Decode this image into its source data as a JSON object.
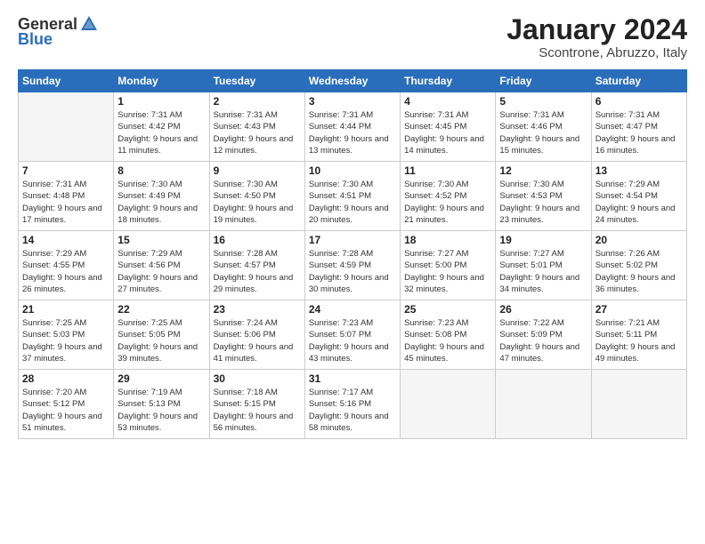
{
  "header": {
    "logo_general": "General",
    "logo_blue": "Blue",
    "month_title": "January 2024",
    "subtitle": "Scontrone, Abruzzo, Italy"
  },
  "days_of_week": [
    "Sunday",
    "Monday",
    "Tuesday",
    "Wednesday",
    "Thursday",
    "Friday",
    "Saturday"
  ],
  "weeks": [
    [
      {
        "day": "",
        "sunrise": "",
        "sunset": "",
        "daylight": ""
      },
      {
        "day": "1",
        "sunrise": "Sunrise: 7:31 AM",
        "sunset": "Sunset: 4:42 PM",
        "daylight": "Daylight: 9 hours and 11 minutes."
      },
      {
        "day": "2",
        "sunrise": "Sunrise: 7:31 AM",
        "sunset": "Sunset: 4:43 PM",
        "daylight": "Daylight: 9 hours and 12 minutes."
      },
      {
        "day": "3",
        "sunrise": "Sunrise: 7:31 AM",
        "sunset": "Sunset: 4:44 PM",
        "daylight": "Daylight: 9 hours and 13 minutes."
      },
      {
        "day": "4",
        "sunrise": "Sunrise: 7:31 AM",
        "sunset": "Sunset: 4:45 PM",
        "daylight": "Daylight: 9 hours and 14 minutes."
      },
      {
        "day": "5",
        "sunrise": "Sunrise: 7:31 AM",
        "sunset": "Sunset: 4:46 PM",
        "daylight": "Daylight: 9 hours and 15 minutes."
      },
      {
        "day": "6",
        "sunrise": "Sunrise: 7:31 AM",
        "sunset": "Sunset: 4:47 PM",
        "daylight": "Daylight: 9 hours and 16 minutes."
      }
    ],
    [
      {
        "day": "7",
        "sunrise": "Sunrise: 7:31 AM",
        "sunset": "Sunset: 4:48 PM",
        "daylight": "Daylight: 9 hours and 17 minutes."
      },
      {
        "day": "8",
        "sunrise": "Sunrise: 7:30 AM",
        "sunset": "Sunset: 4:49 PM",
        "daylight": "Daylight: 9 hours and 18 minutes."
      },
      {
        "day": "9",
        "sunrise": "Sunrise: 7:30 AM",
        "sunset": "Sunset: 4:50 PM",
        "daylight": "Daylight: 9 hours and 19 minutes."
      },
      {
        "day": "10",
        "sunrise": "Sunrise: 7:30 AM",
        "sunset": "Sunset: 4:51 PM",
        "daylight": "Daylight: 9 hours and 20 minutes."
      },
      {
        "day": "11",
        "sunrise": "Sunrise: 7:30 AM",
        "sunset": "Sunset: 4:52 PM",
        "daylight": "Daylight: 9 hours and 21 minutes."
      },
      {
        "day": "12",
        "sunrise": "Sunrise: 7:30 AM",
        "sunset": "Sunset: 4:53 PM",
        "daylight": "Daylight: 9 hours and 23 minutes."
      },
      {
        "day": "13",
        "sunrise": "Sunrise: 7:29 AM",
        "sunset": "Sunset: 4:54 PM",
        "daylight": "Daylight: 9 hours and 24 minutes."
      }
    ],
    [
      {
        "day": "14",
        "sunrise": "Sunrise: 7:29 AM",
        "sunset": "Sunset: 4:55 PM",
        "daylight": "Daylight: 9 hours and 26 minutes."
      },
      {
        "day": "15",
        "sunrise": "Sunrise: 7:29 AM",
        "sunset": "Sunset: 4:56 PM",
        "daylight": "Daylight: 9 hours and 27 minutes."
      },
      {
        "day": "16",
        "sunrise": "Sunrise: 7:28 AM",
        "sunset": "Sunset: 4:57 PM",
        "daylight": "Daylight: 9 hours and 29 minutes."
      },
      {
        "day": "17",
        "sunrise": "Sunrise: 7:28 AM",
        "sunset": "Sunset: 4:59 PM",
        "daylight": "Daylight: 9 hours and 30 minutes."
      },
      {
        "day": "18",
        "sunrise": "Sunrise: 7:27 AM",
        "sunset": "Sunset: 5:00 PM",
        "daylight": "Daylight: 9 hours and 32 minutes."
      },
      {
        "day": "19",
        "sunrise": "Sunrise: 7:27 AM",
        "sunset": "Sunset: 5:01 PM",
        "daylight": "Daylight: 9 hours and 34 minutes."
      },
      {
        "day": "20",
        "sunrise": "Sunrise: 7:26 AM",
        "sunset": "Sunset: 5:02 PM",
        "daylight": "Daylight: 9 hours and 36 minutes."
      }
    ],
    [
      {
        "day": "21",
        "sunrise": "Sunrise: 7:25 AM",
        "sunset": "Sunset: 5:03 PM",
        "daylight": "Daylight: 9 hours and 37 minutes."
      },
      {
        "day": "22",
        "sunrise": "Sunrise: 7:25 AM",
        "sunset": "Sunset: 5:05 PM",
        "daylight": "Daylight: 9 hours and 39 minutes."
      },
      {
        "day": "23",
        "sunrise": "Sunrise: 7:24 AM",
        "sunset": "Sunset: 5:06 PM",
        "daylight": "Daylight: 9 hours and 41 minutes."
      },
      {
        "day": "24",
        "sunrise": "Sunrise: 7:23 AM",
        "sunset": "Sunset: 5:07 PM",
        "daylight": "Daylight: 9 hours and 43 minutes."
      },
      {
        "day": "25",
        "sunrise": "Sunrise: 7:23 AM",
        "sunset": "Sunset: 5:08 PM",
        "daylight": "Daylight: 9 hours and 45 minutes."
      },
      {
        "day": "26",
        "sunrise": "Sunrise: 7:22 AM",
        "sunset": "Sunset: 5:09 PM",
        "daylight": "Daylight: 9 hours and 47 minutes."
      },
      {
        "day": "27",
        "sunrise": "Sunrise: 7:21 AM",
        "sunset": "Sunset: 5:11 PM",
        "daylight": "Daylight: 9 hours and 49 minutes."
      }
    ],
    [
      {
        "day": "28",
        "sunrise": "Sunrise: 7:20 AM",
        "sunset": "Sunset: 5:12 PM",
        "daylight": "Daylight: 9 hours and 51 minutes."
      },
      {
        "day": "29",
        "sunrise": "Sunrise: 7:19 AM",
        "sunset": "Sunset: 5:13 PM",
        "daylight": "Daylight: 9 hours and 53 minutes."
      },
      {
        "day": "30",
        "sunrise": "Sunrise: 7:18 AM",
        "sunset": "Sunset: 5:15 PM",
        "daylight": "Daylight: 9 hours and 56 minutes."
      },
      {
        "day": "31",
        "sunrise": "Sunrise: 7:17 AM",
        "sunset": "Sunset: 5:16 PM",
        "daylight": "Daylight: 9 hours and 58 minutes."
      },
      {
        "day": "",
        "sunrise": "",
        "sunset": "",
        "daylight": ""
      },
      {
        "day": "",
        "sunrise": "",
        "sunset": "",
        "daylight": ""
      },
      {
        "day": "",
        "sunrise": "",
        "sunset": "",
        "daylight": ""
      }
    ]
  ]
}
